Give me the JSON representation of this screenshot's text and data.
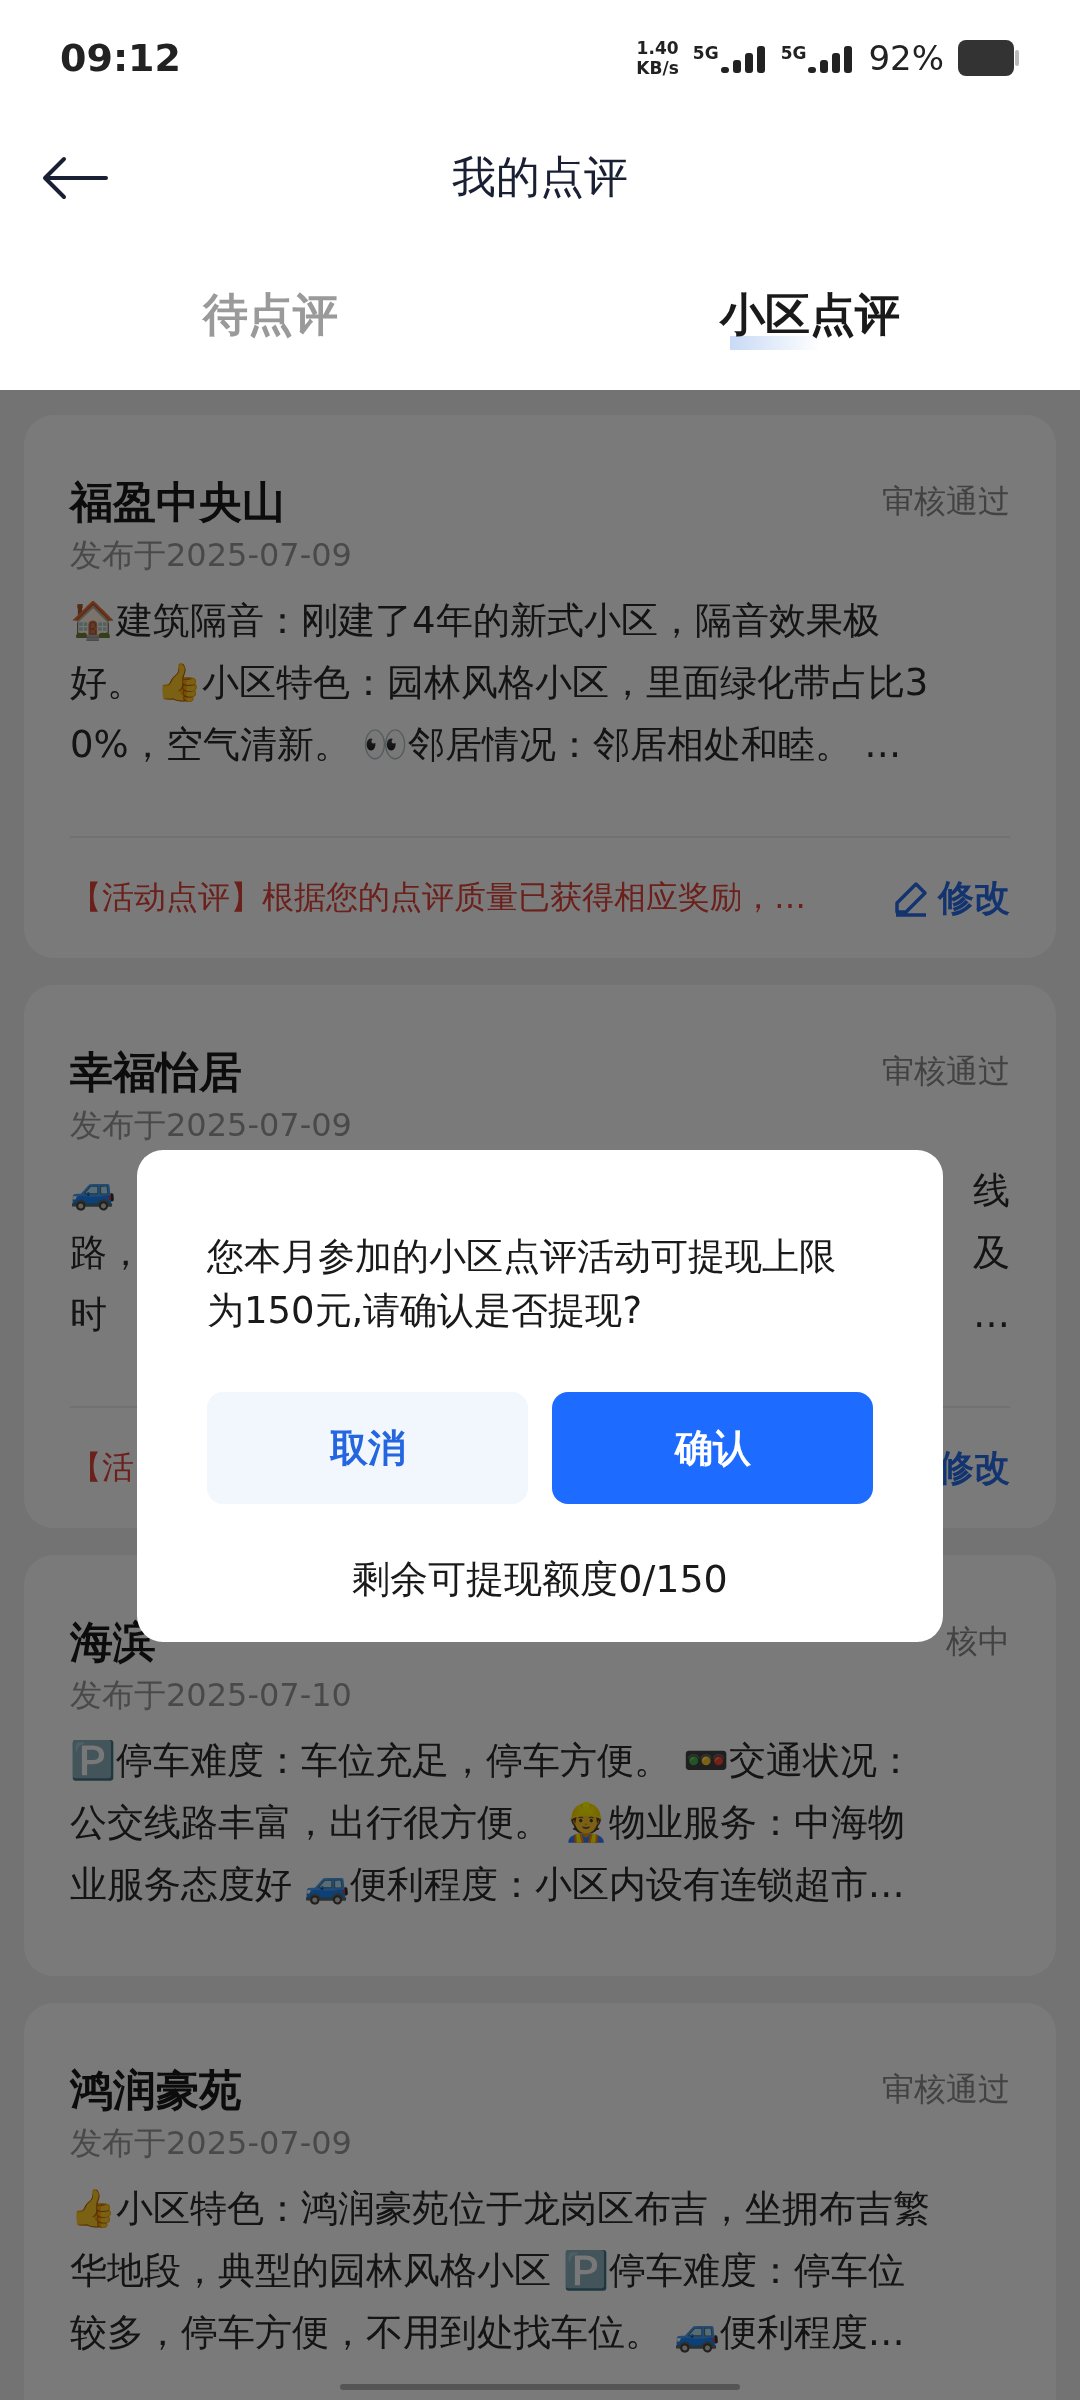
{
  "status_bar": {
    "time": "09:12",
    "speed_value": "1.40",
    "speed_unit": "KB/s",
    "sim_1": "5G",
    "sim_2": "5G",
    "battery": "92%"
  },
  "header": {
    "title": "我的点评"
  },
  "tabs": [
    {
      "label": "待点评",
      "selected": false
    },
    {
      "label": "小区点评",
      "selected": true
    }
  ],
  "reviews": [
    {
      "kind": "full",
      "title": "福盈中央山",
      "status": "审核通过",
      "date": "发布于2025-07-09",
      "body_lines": [
        "🏠建筑隔音：刚建了4年的新式小区，隔音效果极",
        "好。 👍小区特色：园林风格小区，里面绿化带占比3",
        "0%，空气清新。 👀邻居情况：邻居相处和睦。 …"
      ],
      "note": "【活动点评】根据您的点评质量已获得相应奖励，…",
      "edit": "修改",
      "edit_icon": true
    },
    {
      "kind": "split",
      "title": "幸福怡居",
      "status": "审核通过",
      "date": "发布于2025-07-09",
      "body_lines": [
        {
          "left": "🚙",
          "right": "线"
        },
        {
          "left": "路，",
          "right": "及"
        },
        {
          "left": "时",
          "right": "…"
        }
      ],
      "note": "【活",
      "edit": "修改",
      "edit_icon": false
    },
    {
      "kind": "full",
      "title": "海滨",
      "status": "核中",
      "date": "发布于2025-07-10",
      "body_lines": [
        "🅿️停车难度：车位充足，停车方便。 🚥交通状况：",
        "公交线路丰富，出行很方便。 👷物业服务：中海物",
        "业服务态度好 🚙便利程度：小区内设有连锁超市…"
      ]
    },
    {
      "kind": "full",
      "title": "鸿润豪苑",
      "status": "审核通过",
      "date": "发布于2025-07-09",
      "body_lines": [
        "👍小区特色：鸿润豪苑位于龙岗区布吉，坐拥布吉繁",
        "华地段，典型的园林风格小区 🅿️停车难度：停车位",
        "较多，停车方便，不用到处找车位。 🚙便利程度…"
      ]
    }
  ],
  "dialog": {
    "message": "您本月参加的小区点评活动可提现上限为150元,请确认是否提现?",
    "cancel": "取消",
    "confirm": "确认",
    "quota": "剩余可提现额度0/150"
  }
}
